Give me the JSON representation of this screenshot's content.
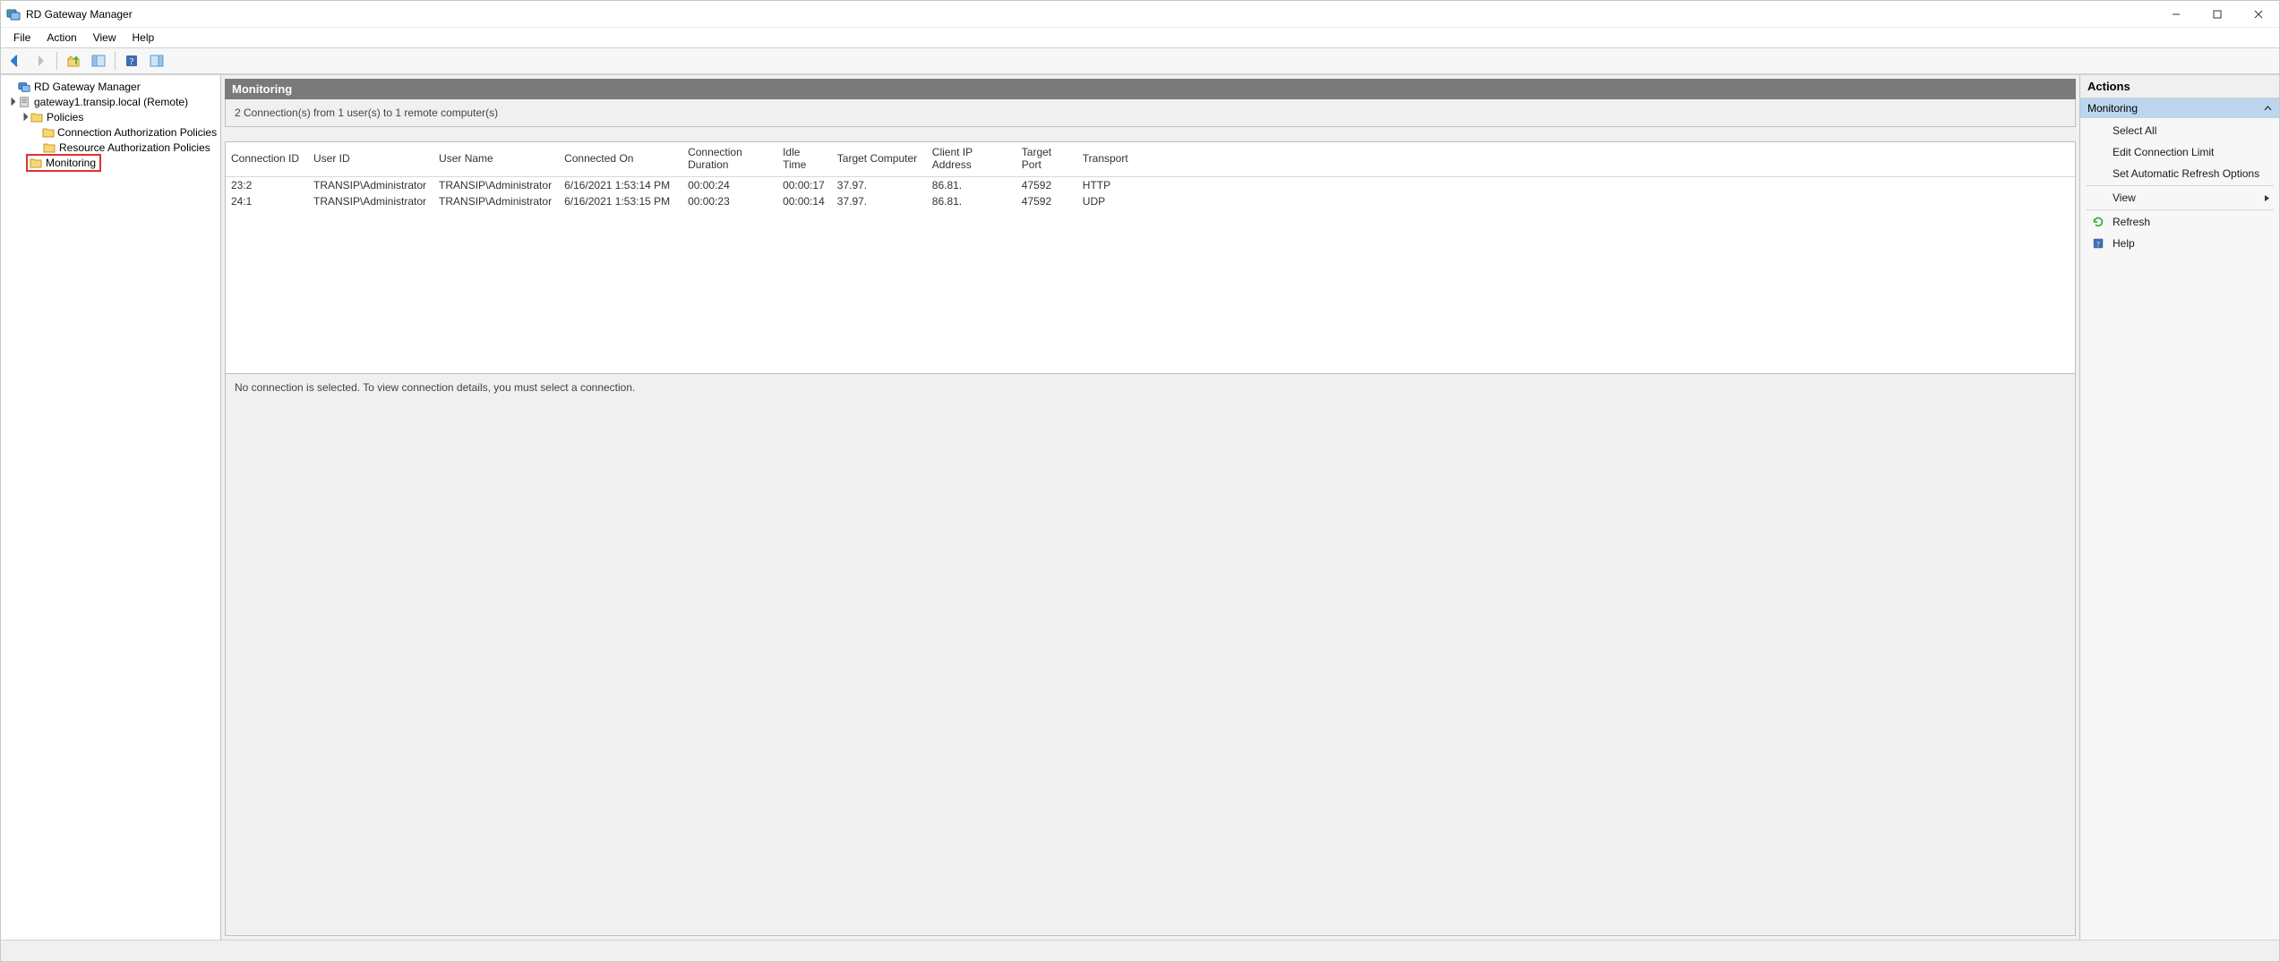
{
  "window": {
    "title": "RD Gateway Manager"
  },
  "menu": {
    "file": "File",
    "action": "Action",
    "view": "View",
    "help": "Help"
  },
  "tree": {
    "root": "RD Gateway Manager",
    "server": "gateway1.transip.local (Remote)",
    "policies": "Policies",
    "cap": "Connection Authorization Policies",
    "rap": "Resource Authorization Policies",
    "monitoring": "Monitoring"
  },
  "center": {
    "title": "Monitoring",
    "summary": "2 Connection(s) from 1 user(s) to 1 remote computer(s)",
    "details_hint": "No connection is selected. To view connection details, you must select a connection.",
    "columns": {
      "connection_id": "Connection ID",
      "user_id": "User ID",
      "user_name": "User Name",
      "connected_on": "Connected On",
      "connection_duration": "Connection Duration",
      "idle_time": "Idle Time",
      "target_computer": "Target Computer",
      "client_ip": "Client IP Address",
      "target_port": "Target Port",
      "transport": "Transport"
    },
    "rows": [
      {
        "connection_id": "23:2",
        "user_id": "TRANSIP\\Administrator",
        "user_name": "TRANSIP\\Administrator",
        "connected_on": "6/16/2021 1:53:14 PM",
        "connection_duration": "00:00:24",
        "idle_time": "00:00:17",
        "target_computer": "37.97.",
        "client_ip": "86.81.",
        "target_port": "47592",
        "transport": "HTTP"
      },
      {
        "connection_id": "24:1",
        "user_id": "TRANSIP\\Administrator",
        "user_name": "TRANSIP\\Administrator",
        "connected_on": "6/16/2021 1:53:15 PM",
        "connection_duration": "00:00:23",
        "idle_time": "00:00:14",
        "target_computer": "37.97.",
        "client_ip": "86.81.",
        "target_port": "47592",
        "transport": "UDP"
      }
    ]
  },
  "actions": {
    "header": "Actions",
    "section": "Monitoring",
    "select_all": "Select All",
    "edit_limit": "Edit Connection Limit",
    "auto_refresh": "Set Automatic Refresh Options",
    "view": "View",
    "refresh": "Refresh",
    "help": "Help"
  }
}
